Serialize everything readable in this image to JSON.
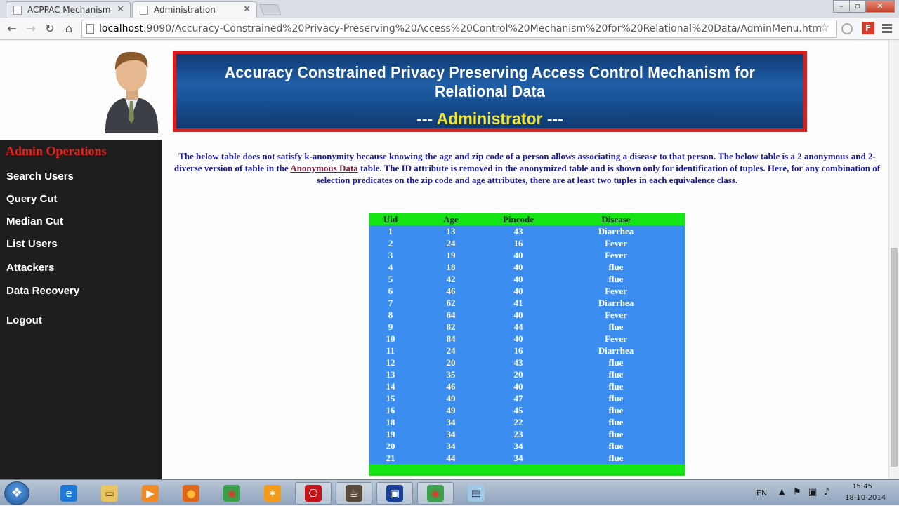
{
  "browser": {
    "tabs": [
      {
        "label": "ACPPAC Mechanism",
        "active": false
      },
      {
        "label": "Administration",
        "active": true
      }
    ],
    "url_host": "localhost",
    "url_rest": ":9090/Accuracy-Constrained%20Privacy-Preserving%20Access%20Control%20Mechanism%20for%20Relational%20Data/AdminMenu.htm",
    "ext_letter": "F"
  },
  "banner": {
    "title": "Accuracy Constrained Privacy Preserving Access Control Mechanism for Relational Data",
    "sub_prefix": "--- ",
    "sub_role": "Administrator",
    "sub_suffix": " ---"
  },
  "sidebar": {
    "heading": "Admin Operations",
    "items": [
      "Search Users",
      "Query Cut",
      "Median Cut",
      "List Users",
      "Attackers",
      "Data Recovery",
      "Logout"
    ]
  },
  "description": {
    "part1": "The below table does not satisfy k-anonymity because knowing the age and zip code of a person allows associating a disease to that person. The below table is a 2 anonymous and 2-diverse version of table in the ",
    "link": "Anonymous Data",
    "part2": " table. The ID attribute is removed in the anonymized table and is shown only for identification of tuples. Here, for any combination of selection predicates on the zip code and age attributes, there are at least two tuples in each equivalence class."
  },
  "table": {
    "headers": [
      "Uid",
      "Age",
      "Pincode",
      "Disease"
    ],
    "rows": [
      [
        "1",
        "13",
        "43",
        "Diarrhea"
      ],
      [
        "2",
        "24",
        "16",
        "Fever"
      ],
      [
        "3",
        "19",
        "40",
        "Fever"
      ],
      [
        "4",
        "18",
        "40",
        "flue"
      ],
      [
        "5",
        "42",
        "40",
        "flue"
      ],
      [
        "6",
        "46",
        "40",
        "Fever"
      ],
      [
        "7",
        "62",
        "41",
        "Diarrhea"
      ],
      [
        "8",
        "64",
        "40",
        "Fever"
      ],
      [
        "9",
        "82",
        "44",
        "flue"
      ],
      [
        "10",
        "84",
        "40",
        "Fever"
      ],
      [
        "11",
        "24",
        "16",
        "Diarrhea"
      ],
      [
        "12",
        "20",
        "43",
        "flue"
      ],
      [
        "13",
        "35",
        "20",
        "flue"
      ],
      [
        "14",
        "46",
        "40",
        "flue"
      ],
      [
        "15",
        "49",
        "47",
        "flue"
      ],
      [
        "16",
        "49",
        "45",
        "flue"
      ],
      [
        "18",
        "34",
        "22",
        "flue"
      ],
      [
        "19",
        "34",
        "23",
        "flue"
      ],
      [
        "20",
        "34",
        "34",
        "flue"
      ],
      [
        "21",
        "44",
        "34",
        "flue"
      ]
    ]
  },
  "taskbar": {
    "apps": [
      "ie-icon",
      "explorer-icon",
      "media-player-icon",
      "firefox-icon",
      "chrome-icon",
      "avast-icon",
      "acrobat-icon",
      "java-ee-icon",
      "remote-icon",
      "chrome-icon",
      "notepad-icon"
    ],
    "lang": "EN",
    "time": "15:45",
    "date": "18-10-2014"
  },
  "colors": {
    "banner_border": "#d61e1e",
    "banner_bg": "#1f5fa8",
    "role_text": "#f3e52c",
    "sidebar_bg": "#1e1e1e",
    "sidebar_heading": "#e8241c",
    "table_header": "#14e314",
    "table_row": "#3b8ef0",
    "desc_text": "#1a1aa0"
  }
}
